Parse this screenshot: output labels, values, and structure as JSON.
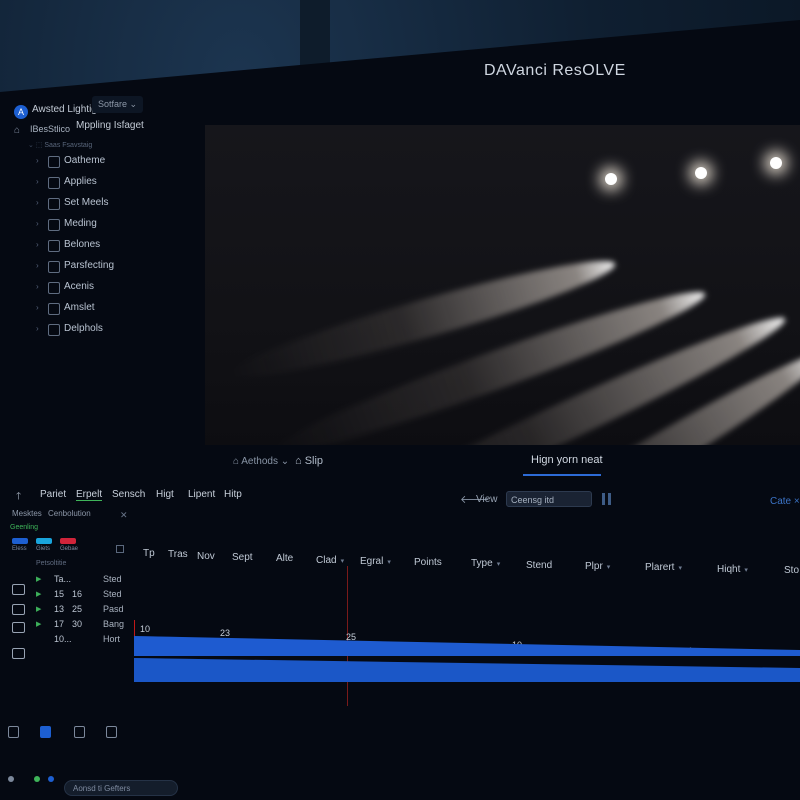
{
  "app": {
    "title": "DAVanci ResOLVE",
    "logo_letter": "A"
  },
  "project": {
    "name": "Awsted Lightig",
    "menu_label": "Sotfare ⌄",
    "row2_left": "IBesStlico",
    "row2_right": "Mppling Isfaget"
  },
  "tree": {
    "header": "Saas Fsavstaig",
    "items": [
      {
        "label": "Oatheme"
      },
      {
        "label": "Applies"
      },
      {
        "label": "Set Meels"
      },
      {
        "label": "Meding"
      },
      {
        "label": "Belones"
      },
      {
        "label": "Parsfecting"
      },
      {
        "label": "Acenis"
      },
      {
        "label": "Amslet"
      },
      {
        "label": "Delphols"
      }
    ]
  },
  "viewer_toolbar": {
    "left": "⌂ Aethods ⌄",
    "mid": "⌂ Slip",
    "right": "Hign yorn neat"
  },
  "menubar": {
    "items": [
      "Pariet",
      "Erpelt",
      "Sensch",
      "Higt",
      "Lipent",
      "Hitp"
    ]
  },
  "view_controls": {
    "view_label": "View",
    "select_value": "Ceensg itd",
    "cut_label": "Cate ×"
  },
  "mini_panel": {
    "tabs": [
      "Mesktes",
      "Cenbolution"
    ],
    "status": "Geenling",
    "chips": [
      {
        "label": "Eless",
        "color": "#1d5fd1"
      },
      {
        "label": "Giets",
        "color": "#19a4dc"
      },
      {
        "label": "Gebae",
        "color": "#d0243a"
      }
    ],
    "sub_header": "Petsoltitie",
    "rows": [
      {
        "c1": "Ta...",
        "c2": "",
        "c3": "Sted"
      },
      {
        "c1": "15",
        "c2": "16",
        "c3": "Sted"
      },
      {
        "c1": "13",
        "c2": "25",
        "c3": "Pasd"
      },
      {
        "c1": "17",
        "c2": "30",
        "c3": "Bang"
      },
      {
        "c1": "10...",
        "c2": "",
        "c3": "Hort"
      }
    ]
  },
  "columns": [
    "Tp",
    "Tras",
    "Nov",
    "Sept",
    "Alte",
    "Clad",
    "Egral",
    "Points",
    "Type",
    "Stend",
    "Plpr",
    "Plarert",
    "Hiqht",
    "Sto"
  ],
  "timeline": {
    "marks": [
      "10",
      "23",
      "25",
      "10",
      "1"
    ]
  },
  "status_bar": {
    "field_text": "Aonsd ti Gefters"
  }
}
